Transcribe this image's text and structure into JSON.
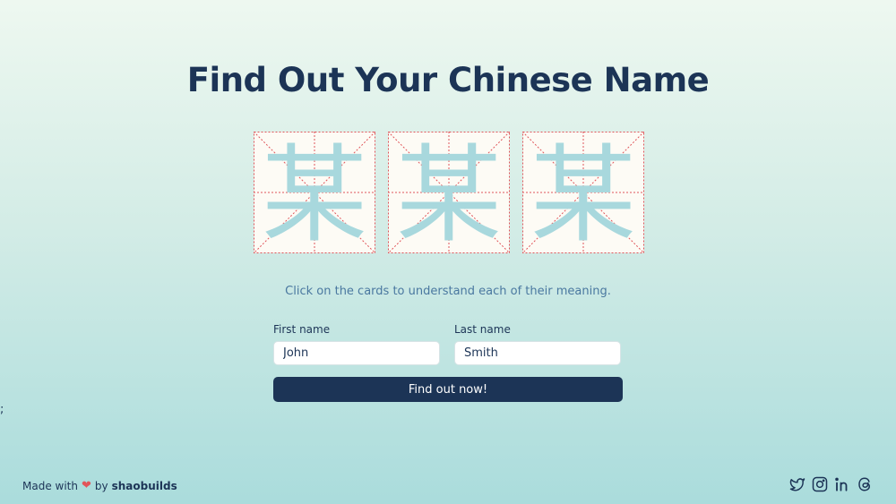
{
  "header": {
    "title": "Find Out Your Chinese Name"
  },
  "cards": [
    {
      "character": "某"
    },
    {
      "character": "某"
    },
    {
      "character": "某"
    }
  ],
  "hint": "Click on the cards to understand each of their meaning.",
  "form": {
    "first_name_label": "First name",
    "first_name_value": "John",
    "last_name_label": "Last name",
    "last_name_value": "Smith",
    "submit_label": "Find out now!"
  },
  "stray_text": ";",
  "footer": {
    "made_with": "Made with",
    "heart": "❤",
    "by": "by",
    "author": "shaobuilds",
    "socials": [
      "twitter-icon",
      "instagram-icon",
      "linkedin-icon",
      "threads-icon"
    ]
  },
  "colors": {
    "primary": "#1c3456",
    "character": "#a8d8dd",
    "guide_lines": "#e0555a",
    "card_bg": "#fdfbf5",
    "hint": "#4a78a0",
    "heart": "#e2555a"
  }
}
